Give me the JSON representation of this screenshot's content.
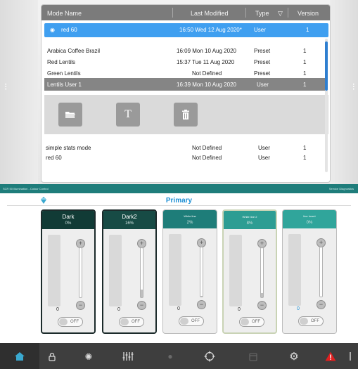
{
  "mode_list": {
    "columns": {
      "name": "Mode Name",
      "modified": "Last Modified",
      "type": "Type",
      "version": "Version"
    },
    "selected": {
      "name": "red 60",
      "modified": "16:50 Wed 12 Aug 2020*",
      "type": "User",
      "version": "1"
    },
    "rows": [
      {
        "name": "Arabica Coffee Brazil",
        "modified": "16:09 Mon 10 Aug 2020",
        "type": "Preset",
        "version": "1"
      },
      {
        "name": "Red Lentils",
        "modified": "15:37 Tue 11 Aug 2020",
        "type": "Preset",
        "version": "1"
      },
      {
        "name": "Green Lentils",
        "modified": "Not Defined",
        "type": "Preset",
        "version": "1"
      },
      {
        "name": "Lentils User 1",
        "modified": "16:39 Mon 10 Aug 2020",
        "type": "User",
        "version": "1"
      }
    ],
    "lower_rows": [
      {
        "name": "simple stats mode",
        "modified": "Not Defined",
        "type": "User",
        "version": "1"
      },
      {
        "name": "red 60",
        "modified": "Not Defined",
        "type": "User",
        "version": "1"
      }
    ],
    "tools": [
      "folder-open-icon",
      "text-t-icon",
      "trash-icon"
    ]
  },
  "lighting": {
    "titlebar_left": "SCR 50 Illumination - Colour Control",
    "titlebar_right": "Service Diagnostics",
    "section_title": "Primary",
    "faders": [
      {
        "name": "Dark",
        "pct": "0%",
        "value": "0",
        "toggle": "OFF",
        "header": "#113b36",
        "style": "sel",
        "level": 0.0
      },
      {
        "name": "Dark2",
        "pct": "16%",
        "value": "0",
        "toggle": "OFF",
        "header": "#174b45",
        "style": "sel",
        "level": 0.16
      },
      {
        "name": "White line",
        "pct": "2%",
        "value": "0",
        "toggle": "OFF",
        "header": "#1e7d79",
        "style": "",
        "level": 0.02
      },
      {
        "name": "White line 2",
        "pct": "8%",
        "value": "0",
        "toggle": "OFF",
        "header": "#2d9d93",
        "style": "sel2",
        "level": 0.08
      },
      {
        "name": "line Invert",
        "pct": "0%",
        "value": "0",
        "toggle": "OFF",
        "header": "#30a59b",
        "style": "",
        "level": 0.0
      }
    ]
  },
  "nav": {
    "icons": [
      "home-icon",
      "lock-icon",
      "settings-cog-icon",
      "sliders-icon",
      "dim-icon",
      "crosshair-icon",
      "calendar-icon",
      "gear-icon",
      "warning-icon",
      "exit-icon"
    ],
    "warning_color": "#e02020",
    "accent_color": "#3aa9d0"
  }
}
